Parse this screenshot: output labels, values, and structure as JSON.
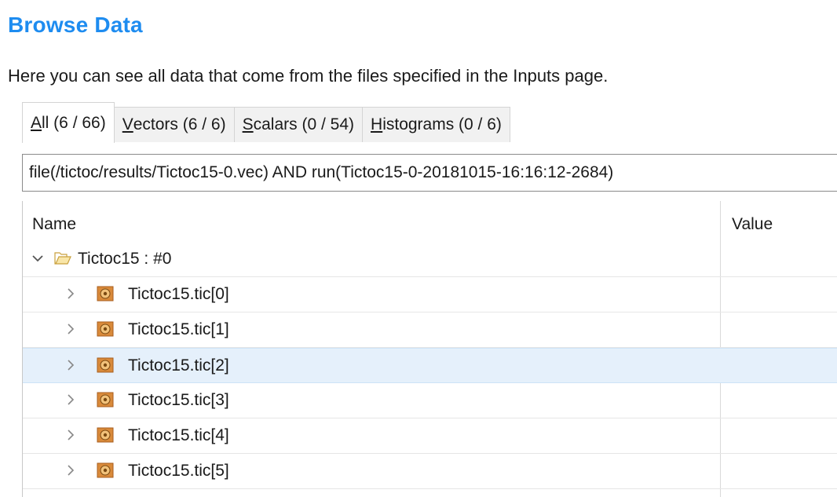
{
  "page": {
    "title": "Browse Data",
    "description": "Here you can see all data that come from the files specified in the Inputs page."
  },
  "tabs": [
    {
      "mnemonic": "A",
      "rest": "ll (6 / 66)",
      "active": true
    },
    {
      "mnemonic": "V",
      "rest": "ectors (6 / 6)",
      "active": false
    },
    {
      "mnemonic": "S",
      "rest": "calars (0 / 54)",
      "active": false
    },
    {
      "mnemonic": "H",
      "rest": "istograms (0 / 6)",
      "active": false
    }
  ],
  "filter": {
    "value": "file(/tictoc/results/Tictoc15-0.vec) AND run(Tictoc15-0-20181015-16:16:12-2684)"
  },
  "tree": {
    "columns": {
      "name": "Name",
      "value": "Value"
    },
    "root": {
      "label": "Tictoc15 : #0",
      "expanded": true,
      "icon": "folder-open-icon"
    },
    "children": [
      {
        "label": "Tictoc15.tic[0]",
        "value": "",
        "icon": "module-icon",
        "selected": false
      },
      {
        "label": "Tictoc15.tic[1]",
        "value": "",
        "icon": "module-icon",
        "selected": false
      },
      {
        "label": "Tictoc15.tic[2]",
        "value": "",
        "icon": "module-icon",
        "selected": true
      },
      {
        "label": "Tictoc15.tic[3]",
        "value": "",
        "icon": "module-icon",
        "selected": false
      },
      {
        "label": "Tictoc15.tic[4]",
        "value": "",
        "icon": "module-icon",
        "selected": false
      },
      {
        "label": "Tictoc15.tic[5]",
        "value": "",
        "icon": "module-icon",
        "selected": false
      }
    ]
  },
  "colors": {
    "title": "#1e8cf0",
    "selection": "#e5f0fb"
  }
}
